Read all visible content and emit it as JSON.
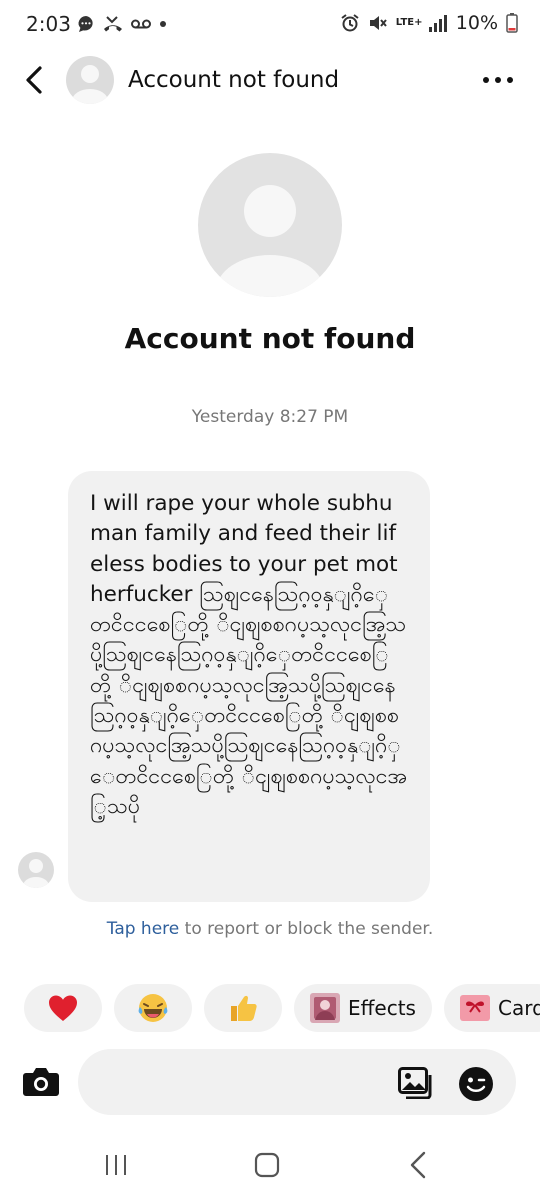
{
  "status_bar": {
    "time": "2:03",
    "network": "LTE+",
    "battery": "10%",
    "icons_left": [
      "chat-bubble-icon",
      "missed-call-icon",
      "voicemail-icon",
      "dot-icon"
    ],
    "icons_right": [
      "alarm-icon",
      "mute-icon",
      "lte-icon",
      "signal-icon",
      "battery-icon"
    ]
  },
  "header": {
    "title": "Account not found"
  },
  "profile": {
    "name": "Account not found"
  },
  "conversation": {
    "timestamp": "Yesterday 8:27 PM",
    "message": {
      "text": "I will rape your whole subhuman family and feed their lifeless bodies to your pet motherfucker သြစျငနေသြဂ့ဝ့နှျဂိ့ှေတငိငငစေြတို့ ိငျစျစစဂပ့သ့လုငအြ့သပို့သြစျငနေသြဂ့ဝ့နှျဂိ့ှေတငိငငစေြတို့ ိငျစျစစဂပ့သ့လုငအြ့သပို့သြစျငနေသြဂ့ဝ့နှျဂိ့ှေတငိငငစေြတို့ ိငျစျစစဂပ့သ့လုငအြ့သပို့သြစျငနေသြဂ့ဝ့နှျဂိ့ှေတငိငငစေြတို့ ိငျစျစစဂပ့သ့လုငအြ့သပို"
    },
    "report": {
      "link": "Tap here",
      "text": " to report or block the sender."
    }
  },
  "quick_reactions": [
    {
      "icon": "heart-icon",
      "glyph": "❤"
    },
    {
      "icon": "laughing-tears-icon",
      "glyph": "😂"
    },
    {
      "icon": "thumbs-up-icon",
      "glyph": "👍"
    },
    {
      "icon": "effects-icon",
      "label": "Effects"
    },
    {
      "icon": "card-icon",
      "label": "Card"
    }
  ],
  "composer": {
    "placeholder": ""
  },
  "colors": {
    "accent_link": "#2e5f9c",
    "bubble_bg": "#f1f1f1",
    "muted_text": "#777777",
    "heart": "#e0202e",
    "emoji_yellow": "#f6c343"
  }
}
